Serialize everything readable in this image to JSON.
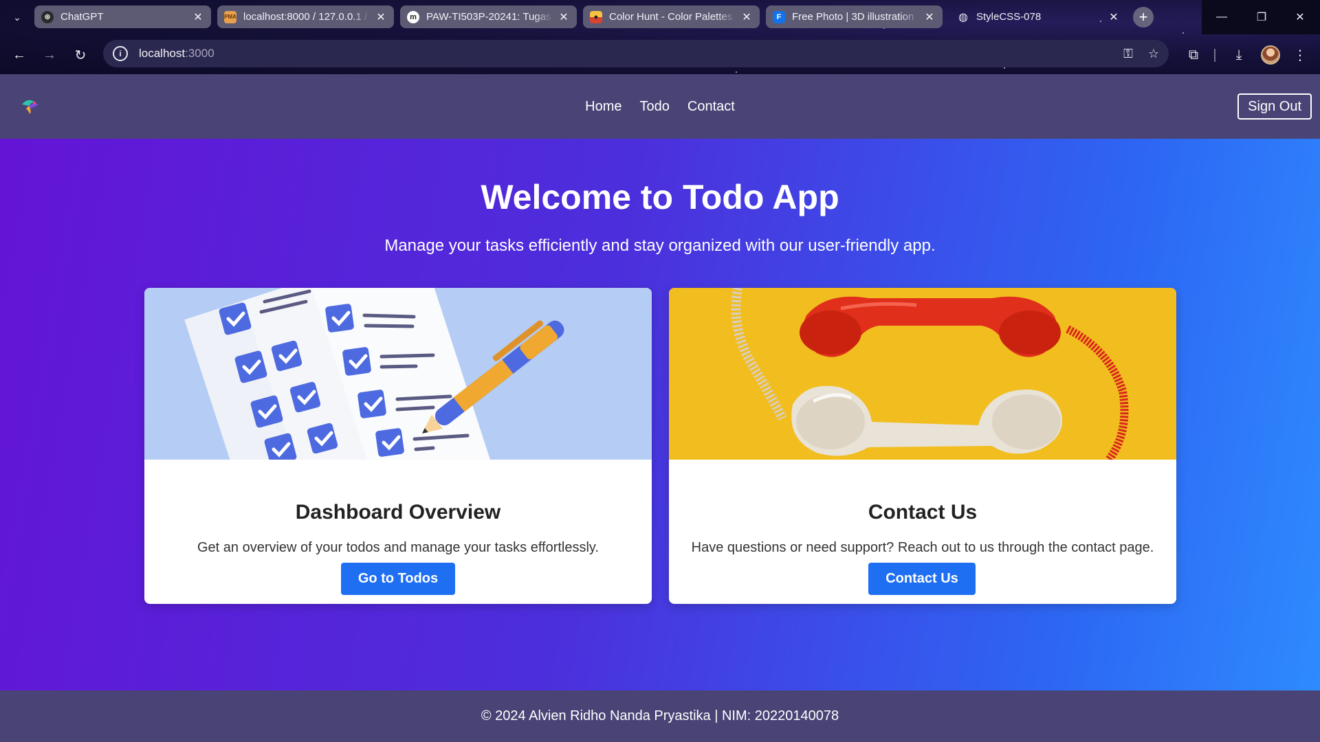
{
  "browser": {
    "tabs": [
      {
        "title": "ChatGPT",
        "icon": "chatgpt-icon"
      },
      {
        "title": "localhost:8000 / 127.0.0.1 / ",
        "icon": "phpmyadmin-icon"
      },
      {
        "title": "PAW-TI503P-20241: Tugas",
        "icon": "moodle-icon"
      },
      {
        "title": "Color Hunt - Color Palettes",
        "icon": "colorhunt-icon"
      },
      {
        "title": "Free Photo | 3D illustration",
        "icon": "freepik-icon"
      },
      {
        "title": "StyleCSS-078",
        "icon": "globe-icon"
      }
    ],
    "url_host": "localhost",
    "url_port": ":3000"
  },
  "site": {
    "nav": {
      "links": [
        "Home",
        "Todo",
        "Contact"
      ],
      "signout": "Sign Out"
    },
    "hero": {
      "title": "Welcome to Todo App",
      "subtitle": "Manage your tasks efficiently and stay organized with our user-friendly app."
    },
    "cards": [
      {
        "title": "Dashboard Overview",
        "text": "Get an overview of your todos and manage your tasks effortlessly.",
        "button": "Go to Todos"
      },
      {
        "title": "Contact Us",
        "text": "Have questions or need support? Reach out to us through the contact page.",
        "button": "Contact Us"
      }
    ],
    "footer": "© 2024 Alvien Ridho Nanda Pryastika | NIM: 20220140078"
  },
  "colors": {
    "nav_bg": "#4a4476",
    "button": "#1f6ff2",
    "hero_start": "#6414d6",
    "hero_end": "#2e8cff"
  }
}
